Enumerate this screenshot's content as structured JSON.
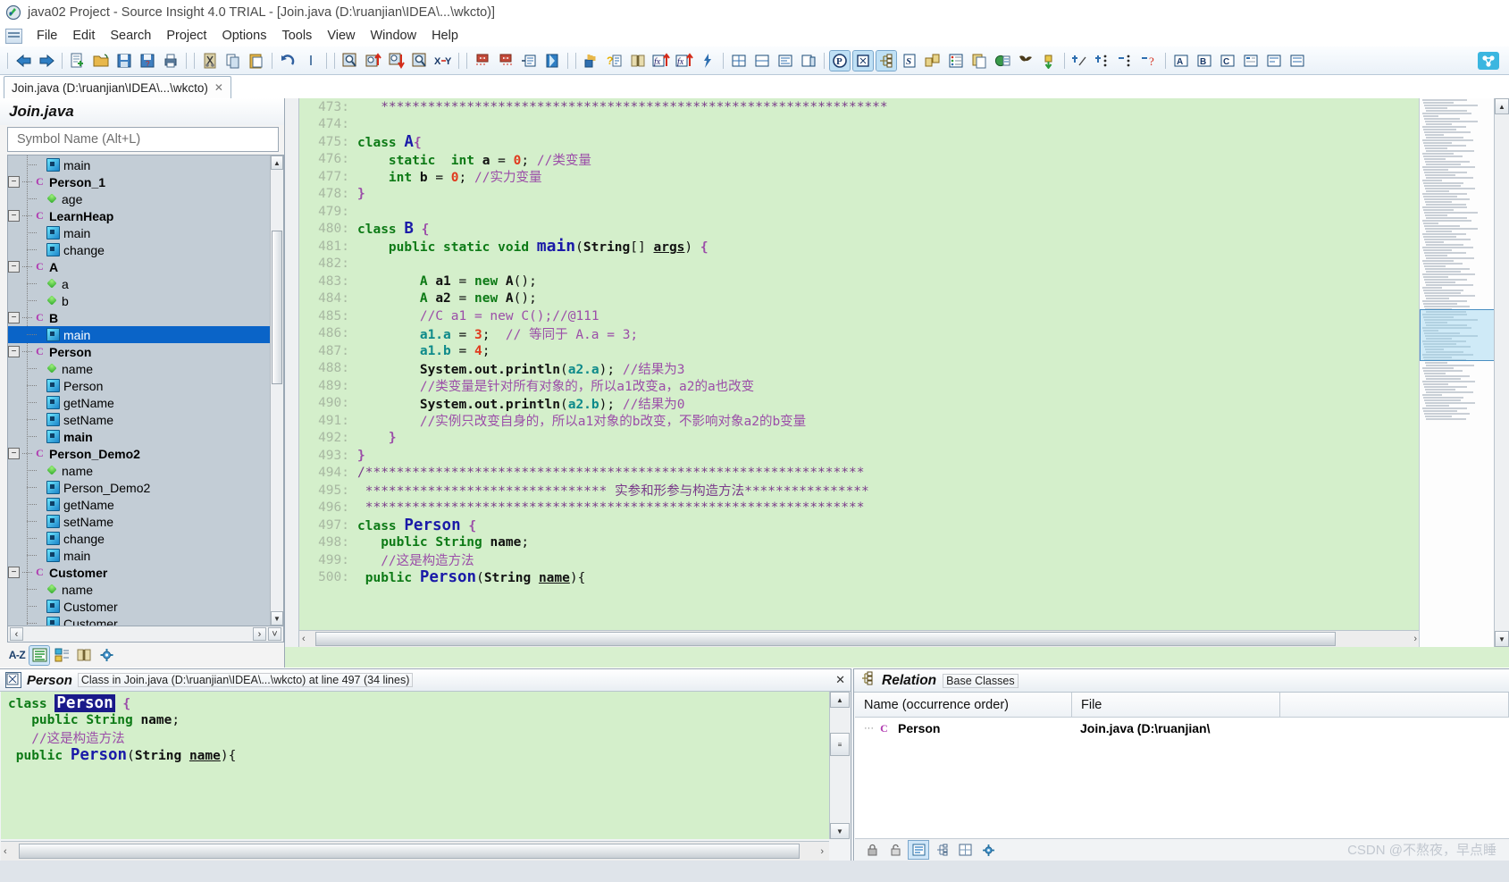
{
  "window": {
    "title": "java02 Project - Source Insight 4.0 TRIAL - [Join.java (D:\\ruanjian\\IDEA\\...\\wkcto)]",
    "app_icon": "source-insight-icon"
  },
  "menu": {
    "items": [
      "File",
      "Edit",
      "Search",
      "Project",
      "Options",
      "Tools",
      "View",
      "Window",
      "Help"
    ]
  },
  "toolbar": {
    "groups": [
      [
        "back-icon",
        "forward-icon"
      ],
      [
        "new-file-icon",
        "open-folder-icon",
        "save-icon",
        "save-all-icon",
        "print-icon"
      ],
      [
        "cut-icon",
        "copy-icon",
        "paste-icon"
      ],
      [
        "undo-icon",
        "redo-icon"
      ],
      [
        "search-icon",
        "search-up-icon",
        "search-down-icon",
        "search-all-icon",
        "replace-icon"
      ],
      [
        "jump-back-icon",
        "jump-forward-icon",
        "jump-to-icon",
        "symbol-window-icon"
      ],
      [
        "highlight-icon",
        "context-help-icon",
        "book-icon",
        "function-up-icon",
        "function-down-icon",
        "lightning-icon"
      ],
      [
        "tile-horizontal-icon",
        "tile-vertical-icon",
        "split-icon",
        "clone-window-icon"
      ],
      [
        "project-window-icon",
        "symbol-window-toggle-icon",
        "relation-window-icon",
        "source-links-icon",
        "file-compare-icon",
        "bookmarks-icon",
        "clip-window-icon",
        "browse-icon",
        "expand-icon",
        "collapse-icon"
      ],
      [
        "add-bookmark-icon",
        "next-bookmark-icon",
        "prev-bookmark-icon",
        "clear-bookmarks-icon"
      ],
      [
        "panel-a-icon",
        "panel-b-icon",
        "panel-c-icon",
        "panel-d-icon",
        "panel-e-icon",
        "panel-f-icon"
      ]
    ],
    "right_logo": "si-logo-icon"
  },
  "tabs": [
    {
      "label": "Join.java (D:\\ruanjian\\IDEA\\...\\wkcto)",
      "close": "✕",
      "active": true
    }
  ],
  "symbol_panel": {
    "title": "Join.java",
    "search_placeholder": "Symbol Name (Alt+L)",
    "search_value": "",
    "tree": [
      {
        "depth": 1,
        "kind": "method",
        "label": "main",
        "bold": false,
        "expander": "",
        "selected": false
      },
      {
        "depth": 0,
        "kind": "class",
        "label": "Person_1",
        "bold": true,
        "expander": "-",
        "selected": false
      },
      {
        "depth": 1,
        "kind": "var",
        "label": "age",
        "bold": false,
        "expander": "",
        "selected": false
      },
      {
        "depth": 0,
        "kind": "class",
        "label": "LearnHeap",
        "bold": true,
        "expander": "-",
        "selected": false
      },
      {
        "depth": 1,
        "kind": "method",
        "label": "main",
        "bold": false,
        "expander": "",
        "selected": false
      },
      {
        "depth": 1,
        "kind": "method",
        "label": "change",
        "bold": false,
        "expander": "",
        "selected": false
      },
      {
        "depth": 0,
        "kind": "class",
        "label": "A",
        "bold": true,
        "expander": "-",
        "selected": false
      },
      {
        "depth": 1,
        "kind": "var",
        "label": "a",
        "bold": false,
        "expander": "",
        "selected": false
      },
      {
        "depth": 1,
        "kind": "var",
        "label": "b",
        "bold": false,
        "expander": "",
        "selected": false
      },
      {
        "depth": 0,
        "kind": "class",
        "label": "B",
        "bold": true,
        "expander": "-",
        "selected": false
      },
      {
        "depth": 1,
        "kind": "method",
        "label": "main",
        "bold": false,
        "expander": "",
        "selected": true
      },
      {
        "depth": 0,
        "kind": "class",
        "label": "Person",
        "bold": true,
        "expander": "-",
        "selected": false
      },
      {
        "depth": 1,
        "kind": "var",
        "label": "name",
        "bold": false,
        "expander": "",
        "selected": false
      },
      {
        "depth": 1,
        "kind": "method",
        "label": "Person",
        "bold": false,
        "expander": "",
        "selected": false
      },
      {
        "depth": 1,
        "kind": "method",
        "label": "getName",
        "bold": false,
        "expander": "",
        "selected": false
      },
      {
        "depth": 1,
        "kind": "method",
        "label": "setName",
        "bold": false,
        "expander": "",
        "selected": false
      },
      {
        "depth": 1,
        "kind": "method",
        "label": "main",
        "bold": true,
        "expander": "",
        "selected": false
      },
      {
        "depth": 0,
        "kind": "class",
        "label": "Person_Demo2",
        "bold": true,
        "expander": "-",
        "selected": false
      },
      {
        "depth": 1,
        "kind": "var",
        "label": "name",
        "bold": false,
        "expander": "",
        "selected": false
      },
      {
        "depth": 1,
        "kind": "method",
        "label": "Person_Demo2",
        "bold": false,
        "expander": "",
        "selected": false
      },
      {
        "depth": 1,
        "kind": "method",
        "label": "getName",
        "bold": false,
        "expander": "",
        "selected": false
      },
      {
        "depth": 1,
        "kind": "method",
        "label": "setName",
        "bold": false,
        "expander": "",
        "selected": false
      },
      {
        "depth": 1,
        "kind": "method",
        "label": "change",
        "bold": false,
        "expander": "",
        "selected": false
      },
      {
        "depth": 1,
        "kind": "method",
        "label": "main",
        "bold": false,
        "expander": "",
        "selected": false
      },
      {
        "depth": 0,
        "kind": "class",
        "label": "Customer",
        "bold": true,
        "expander": "-",
        "selected": false
      },
      {
        "depth": 1,
        "kind": "var",
        "label": "name",
        "bold": false,
        "expander": "",
        "selected": false
      },
      {
        "depth": 1,
        "kind": "method",
        "label": "Customer",
        "bold": false,
        "expander": "",
        "selected": false
      },
      {
        "depth": 1,
        "kind": "method",
        "label": "Customer",
        "bold": false,
        "expander": "",
        "selected": false
      }
    ],
    "buttons": [
      "sort-az-button",
      "symbol-list-button",
      "symbol-type-button",
      "reference-button",
      "options-button"
    ],
    "sort_label": "A-Z"
  },
  "editor": {
    "first_line": 473,
    "lines": [
      {
        "n": 473,
        "html": "   <span class='stars'>*****************************************************************</span>"
      },
      {
        "n": 474,
        "html": ""
      },
      {
        "n": 475,
        "html": "<span class='kw'>class</span> <span class='cls'>A</span><span class='brace'>{</span>"
      },
      {
        "n": 476,
        "html": "    <span class='kw'>static</span>  <span class='kw'>int</span> <span class='ident'>a</span> = <span class='num'>0</span>; <span class='cmt'>//类变量</span>"
      },
      {
        "n": 477,
        "html": "    <span class='kw'>int</span> <span class='ident'>b</span> = <span class='num'>0</span>; <span class='cmt'>//实力变量</span>"
      },
      {
        "n": 478,
        "html": "<span class='brace'>}</span>"
      },
      {
        "n": 479,
        "html": ""
      },
      {
        "n": 480,
        "html": "<span class='kw'>class</span> <span class='cls'>B</span> <span class='brace'>{</span>"
      },
      {
        "n": 481,
        "html": "    <span class='kw'>public static void</span> <span class='bigm'>main</span>(<span class='ident'>String</span>[] <span class='param'>args</span>) <span class='brace'>{</span>"
      },
      {
        "n": 482,
        "html": ""
      },
      {
        "n": 483,
        "html": "        <span class='kw'>A</span> <span class='ident'>a1</span> = <span class='kw'>new</span> <span class='ident'>A</span>();"
      },
      {
        "n": 484,
        "html": "        <span class='kw'>A</span> <span class='ident'>a2</span> = <span class='kw'>new</span> <span class='ident'>A</span>();"
      },
      {
        "n": 485,
        "html": "        <span class='cmt'>//C a1 = new C();//@111</span>"
      },
      {
        "n": 486,
        "html": "        <span class='field'>a1.a</span> = <span class='num'>3</span>;  <span class='cmt'>// 等同于 A.a = 3;</span>"
      },
      {
        "n": 487,
        "html": "        <span class='field'>a1.b</span> = <span class='num'>4</span>;"
      },
      {
        "n": 488,
        "html": "        <span class='ident'>System.out.println</span>(<span class='field'>a2.a</span>); <span class='cmt'>//结果为3</span>"
      },
      {
        "n": 489,
        "html": "        <span class='cmt'>//类变量是针对所有对象的，所以a1改变a，a2的a也改变</span>"
      },
      {
        "n": 490,
        "html": "        <span class='ident'>System.out.println</span>(<span class='field'>a2.b</span>); <span class='cmt'>//结果为0</span>"
      },
      {
        "n": 491,
        "html": "        <span class='cmt'>//实例只改变自身的，所以a1对象的b改变，不影响对象a2的b变量</span>"
      },
      {
        "n": 492,
        "html": "    <span class='brace'>}</span>"
      },
      {
        "n": 493,
        "html": "<span class='brace'>}</span>"
      },
      {
        "n": 494,
        "html": "<span class='stars'>/****************************************************************</span>"
      },
      {
        "n": 495,
        "html": " <span class='stars'>******************************* 实参和形参与构造方法****************</span>"
      },
      {
        "n": 496,
        "html": " <span class='stars'>****************************************************************</span>"
      },
      {
        "n": 497,
        "html": "<span class='kw'>class</span> <span class='cls'>Person</span> <span class='brace'>{</span>"
      },
      {
        "n": 498,
        "html": "   <span class='kw'>public</span> <span class='kw'>String</span> <span class='ident'>name</span>;"
      },
      {
        "n": 499,
        "html": "   <span class='cmt'>//这是构造方法</span>"
      },
      {
        "n": 500,
        "html": " <span class='kw'>public</span> <span class='cls'>Person</span>(<span class='ident'>String</span> <span class='param'>name</span>){"
      }
    ]
  },
  "context_panel": {
    "title": "Person",
    "subtitle": "Class in Join.java (D:\\ruanjian\\IDEA\\...\\wkcto) at line 497 (34 lines)",
    "close": "✕",
    "lines": [
      {
        "html": "<span class='kw'>class</span> <span class='sel-ident'>Person</span> <span class='brace'>{</span>"
      },
      {
        "html": "   <span class='kw'>public</span> <span class='kw'>String</span> <span class='ident'>name</span>;"
      },
      {
        "html": "   <span class='cmt'>//这是构造方法</span>"
      },
      {
        "html": " <span class='kw'>public</span> <span class='cls'>Person</span>(<span class='ident'>String</span> <span class='param'>name</span>){"
      }
    ]
  },
  "relation_panel": {
    "title": "Relation",
    "subtitle": "Base Classes",
    "close": "✕",
    "columns": [
      "Name (occurrence order)",
      "File",
      ""
    ],
    "rows": [
      {
        "icon": "class-icon",
        "name": "Person",
        "file": "Join.java (D:\\ruanjian\\"
      }
    ]
  },
  "statusbar": {
    "left_buttons": [
      "back-icon",
      "forward-icon",
      "highlight-icon",
      "context-help-icon",
      "book-icon",
      "reference-icon",
      "relation-icon",
      "lock-icon",
      "options-icon"
    ],
    "right_buttons": [
      "lock-icon",
      "unlock-icon",
      "list-icon",
      "tree-icon",
      "grid-icon",
      "options-icon"
    ]
  },
  "watermark": "CSDN @不熬夜，早点睡",
  "colors": {
    "code_bg": "#d4efcb",
    "selection": "#0a64c8",
    "keyword": "#0d7a16",
    "classname": "#1a1aa8",
    "comment": "#9b4ea8",
    "number": "#e03a1e",
    "field": "#0d8a8a",
    "stars": "#7a3b8a"
  }
}
